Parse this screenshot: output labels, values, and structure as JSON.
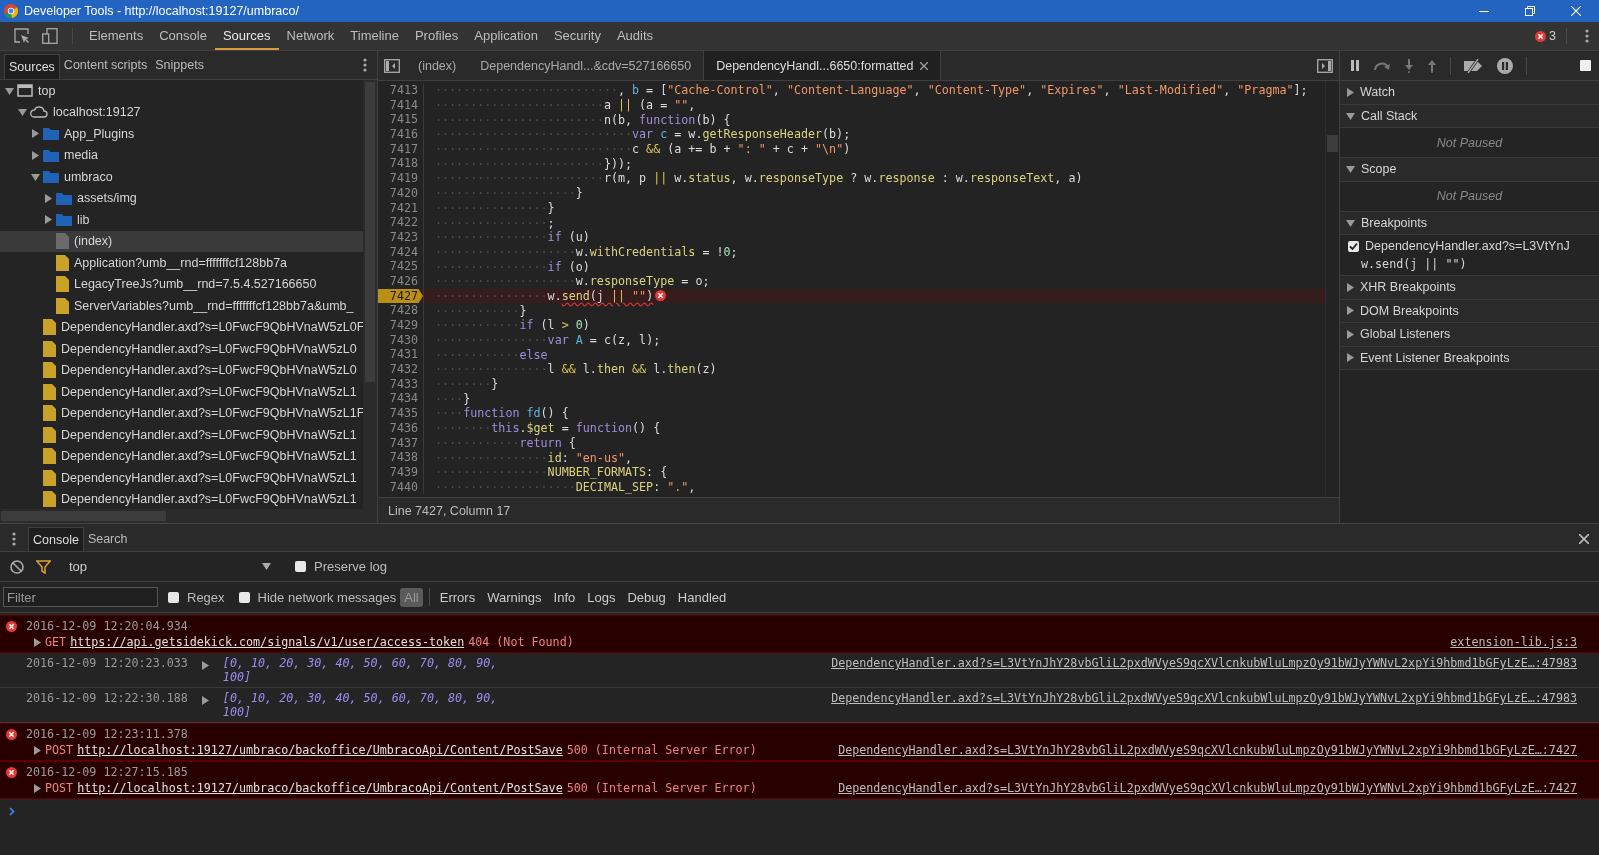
{
  "window": {
    "title": "Developer Tools - http://localhost:19127/umbraco/"
  },
  "main_tabs": [
    {
      "label": "Elements",
      "selected": false
    },
    {
      "label": "Console",
      "selected": false
    },
    {
      "label": "Sources",
      "selected": true
    },
    {
      "label": "Network",
      "selected": false
    },
    {
      "label": "Timeline",
      "selected": false
    },
    {
      "label": "Profiles",
      "selected": false
    },
    {
      "label": "Application",
      "selected": false
    },
    {
      "label": "Security",
      "selected": false
    },
    {
      "label": "Audits",
      "selected": false
    }
  ],
  "error_count": "3",
  "sidebar": {
    "tabs": [
      {
        "label": "Sources",
        "selected": true
      },
      {
        "label": "Content scripts",
        "selected": false
      },
      {
        "label": "Snippets",
        "selected": false
      }
    ],
    "tree": [
      {
        "label": "top",
        "kind": "frame",
        "expanded": true,
        "selected": false,
        "children": [
          {
            "label": "localhost:19127",
            "kind": "domain",
            "expanded": true,
            "selected": false,
            "children": [
              {
                "label": "App_Plugins",
                "kind": "folder",
                "expanded": false,
                "selected": false
              },
              {
                "label": "media",
                "kind": "folder",
                "expanded": false,
                "selected": false
              },
              {
                "label": "umbraco",
                "kind": "folder",
                "expanded": true,
                "selected": false,
                "children": [
                  {
                    "label": "assets/img",
                    "kind": "folder",
                    "expanded": false,
                    "selected": false
                  },
                  {
                    "label": "lib",
                    "kind": "folder",
                    "expanded": false,
                    "selected": false
                  },
                  {
                    "label": "(index)",
                    "kind": "document",
                    "selected": true
                  },
                  {
                    "label": "Application?umb__rnd=fffffffcf128bb7a",
                    "kind": "script",
                    "selected": false
                  },
                  {
                    "label": "LegacyTreeJs?umb__rnd=7.5.4.527166650",
                    "kind": "script",
                    "selected": false
                  },
                  {
                    "label": "ServerVariables?umb__rnd=fffffffcf128bb7a&umb_",
                    "kind": "script",
                    "selected": false
                  }
                ]
              },
              {
                "label": "DependencyHandler.axd?s=L0FwcF9QbHVnaW5zL0F",
                "kind": "script",
                "selected": false
              },
              {
                "label": "DependencyHandler.axd?s=L0FwcF9QbHVnaW5zL0",
                "kind": "script",
                "selected": false
              },
              {
                "label": "DependencyHandler.axd?s=L0FwcF9QbHVnaW5zL0",
                "kind": "script",
                "selected": false
              },
              {
                "label": "DependencyHandler.axd?s=L0FwcF9QbHVnaW5zL1",
                "kind": "script",
                "selected": false
              },
              {
                "label": "DependencyHandler.axd?s=L0FwcF9QbHVnaW5zL1F",
                "kind": "script",
                "selected": false
              },
              {
                "label": "DependencyHandler.axd?s=L0FwcF9QbHVnaW5zL1",
                "kind": "script",
                "selected": false
              },
              {
                "label": "DependencyHandler.axd?s=L0FwcF9QbHVnaW5zL1",
                "kind": "script",
                "selected": false
              },
              {
                "label": "DependencyHandler.axd?s=L0FwcF9QbHVnaW5zL1",
                "kind": "script",
                "selected": false
              },
              {
                "label": "DependencyHandler.axd?s=L0FwcF9QbHVnaW5zL1",
                "kind": "script",
                "selected": false
              }
            ]
          }
        ]
      }
    ]
  },
  "editor": {
    "tabs": [
      {
        "label": "(index)",
        "selected": false
      },
      {
        "label": "DependencyHandl...&cdv=527166650",
        "selected": false
      },
      {
        "label": "DependencyHandl...6650:formatted",
        "selected": true
      }
    ],
    "lines": [
      {
        "number": "7413",
        "breakpoint": false,
        "error": false,
        "segments": [
          {
            "kind": "whitespace",
            "text": "··························"
          },
          {
            "kind": "plain",
            "text": ", "
          },
          {
            "kind": "name",
            "text": "b"
          },
          {
            "kind": "plain",
            "text": " = ["
          },
          {
            "kind": "string",
            "text": "\"Cache-Control\""
          },
          {
            "kind": "plain",
            "text": ", "
          },
          {
            "kind": "string",
            "text": "\"Content-Language\""
          },
          {
            "kind": "plain",
            "text": ", "
          },
          {
            "kind": "string",
            "text": "\"Content-Type\""
          },
          {
            "kind": "plain",
            "text": ", "
          },
          {
            "kind": "string",
            "text": "\"Expires\""
          },
          {
            "kind": "plain",
            "text": ", "
          },
          {
            "kind": "string",
            "text": "\"Last-Modified\""
          },
          {
            "kind": "plain",
            "text": ", "
          },
          {
            "kind": "string",
            "text": "\"Pragma\""
          },
          {
            "kind": "plain",
            "text": "];"
          }
        ]
      },
      {
        "number": "7414",
        "breakpoint": false,
        "error": false,
        "segments": [
          {
            "kind": "whitespace",
            "text": "························"
          },
          {
            "kind": "plain",
            "text": "a "
          },
          {
            "kind": "operator",
            "text": "||"
          },
          {
            "kind": "plain",
            "text": " (a = "
          },
          {
            "kind": "string",
            "text": "\"\""
          },
          {
            "kind": "plain",
            "text": ","
          }
        ]
      },
      {
        "number": "7415",
        "breakpoint": false,
        "error": false,
        "segments": [
          {
            "kind": "whitespace",
            "text": "························"
          },
          {
            "kind": "plain",
            "text": "n(b, "
          },
          {
            "kind": "keyword",
            "text": "function"
          },
          {
            "kind": "plain",
            "text": "(b) {"
          }
        ]
      },
      {
        "number": "7416",
        "breakpoint": false,
        "error": false,
        "segments": [
          {
            "kind": "whitespace",
            "text": "····························"
          },
          {
            "kind": "keyword",
            "text": "var"
          },
          {
            "kind": "name",
            "text": " c"
          },
          {
            "kind": "plain",
            "text": " = w."
          },
          {
            "kind": "property",
            "text": "getResponseHeader"
          },
          {
            "kind": "plain",
            "text": "(b);"
          }
        ]
      },
      {
        "number": "7417",
        "breakpoint": false,
        "error": false,
        "segments": [
          {
            "kind": "whitespace",
            "text": "····························"
          },
          {
            "kind": "plain",
            "text": "c "
          },
          {
            "kind": "operator",
            "text": "&&"
          },
          {
            "kind": "plain",
            "text": " (a += b + "
          },
          {
            "kind": "string",
            "text": "\": \""
          },
          {
            "kind": "plain",
            "text": " + c + "
          },
          {
            "kind": "string",
            "text": "\"\\n\""
          },
          {
            "kind": "plain",
            "text": ")"
          }
        ]
      },
      {
        "number": "7418",
        "breakpoint": false,
        "error": false,
        "segments": [
          {
            "kind": "whitespace",
            "text": "························"
          },
          {
            "kind": "plain",
            "text": "}));"
          }
        ]
      },
      {
        "number": "7419",
        "breakpoint": false,
        "error": false,
        "segments": [
          {
            "kind": "whitespace",
            "text": "························"
          },
          {
            "kind": "plain",
            "text": "r(m, p "
          },
          {
            "kind": "operator",
            "text": "||"
          },
          {
            "kind": "plain",
            "text": " w."
          },
          {
            "kind": "property",
            "text": "status"
          },
          {
            "kind": "plain",
            "text": ", w."
          },
          {
            "kind": "property",
            "text": "responseType"
          },
          {
            "kind": "plain",
            "text": " ? w."
          },
          {
            "kind": "property",
            "text": "response"
          },
          {
            "kind": "plain",
            "text": " : w."
          },
          {
            "kind": "property",
            "text": "responseText"
          },
          {
            "kind": "plain",
            "text": ", a)"
          }
        ]
      },
      {
        "number": "7420",
        "breakpoint": false,
        "error": false,
        "segments": [
          {
            "kind": "whitespace",
            "text": "····················"
          },
          {
            "kind": "plain",
            "text": "}"
          }
        ]
      },
      {
        "number": "7421",
        "breakpoint": false,
        "error": false,
        "segments": [
          {
            "kind": "whitespace",
            "text": "················"
          },
          {
            "kind": "plain",
            "text": "}"
          }
        ]
      },
      {
        "number": "7422",
        "breakpoint": false,
        "error": false,
        "segments": [
          {
            "kind": "whitespace",
            "text": "················"
          },
          {
            "kind": "plain",
            "text": ";"
          }
        ]
      },
      {
        "number": "7423",
        "breakpoint": false,
        "error": false,
        "segments": [
          {
            "kind": "whitespace",
            "text": "················"
          },
          {
            "kind": "keyword",
            "text": "if"
          },
          {
            "kind": "plain",
            "text": " (u)"
          }
        ]
      },
      {
        "number": "7424",
        "breakpoint": false,
        "error": false,
        "segments": [
          {
            "kind": "whitespace",
            "text": "····················"
          },
          {
            "kind": "plain",
            "text": "w."
          },
          {
            "kind": "property",
            "text": "withCredentials"
          },
          {
            "kind": "plain",
            "text": " = !"
          },
          {
            "kind": "number",
            "text": "0"
          },
          {
            "kind": "plain",
            "text": ";"
          }
        ]
      },
      {
        "number": "7425",
        "breakpoint": false,
        "error": false,
        "segments": [
          {
            "kind": "whitespace",
            "text": "················"
          },
          {
            "kind": "keyword",
            "text": "if"
          },
          {
            "kind": "plain",
            "text": " (o)"
          }
        ]
      },
      {
        "number": "7426",
        "breakpoint": false,
        "error": false,
        "segments": [
          {
            "kind": "whitespace",
            "text": "····················"
          },
          {
            "kind": "plain",
            "text": "w."
          },
          {
            "kind": "property",
            "text": "responseType"
          },
          {
            "kind": "plain",
            "text": " = o;"
          }
        ]
      },
      {
        "number": "7427",
        "breakpoint": true,
        "error": true,
        "segments": [
          {
            "kind": "whitespace",
            "text": "················"
          },
          {
            "kind": "plain",
            "text": "w."
          },
          {
            "kind": "property",
            "text": "send",
            "squiggle": true
          },
          {
            "kind": "plain",
            "text": "(j ",
            "squiggle": true
          },
          {
            "kind": "operator",
            "text": "||",
            "squiggle": true
          },
          {
            "kind": "string",
            "text": " \"\"",
            "squiggle": true
          },
          {
            "kind": "plain",
            "text": ")",
            "squiggle": true
          }
        ]
      },
      {
        "number": "7428",
        "breakpoint": false,
        "error": false,
        "segments": [
          {
            "kind": "whitespace",
            "text": "············"
          },
          {
            "kind": "plain",
            "text": "}"
          }
        ]
      },
      {
        "number": "7429",
        "breakpoint": false,
        "error": false,
        "segments": [
          {
            "kind": "whitespace",
            "text": "············"
          },
          {
            "kind": "keyword",
            "text": "if"
          },
          {
            "kind": "plain",
            "text": " (l "
          },
          {
            "kind": "operator",
            "text": ">"
          },
          {
            "kind": "number",
            "text": " 0"
          },
          {
            "kind": "plain",
            "text": ")"
          }
        ]
      },
      {
        "number": "7430",
        "breakpoint": false,
        "error": false,
        "segments": [
          {
            "kind": "whitespace",
            "text": "················"
          },
          {
            "kind": "keyword",
            "text": "var"
          },
          {
            "kind": "name",
            "text": " A"
          },
          {
            "kind": "plain",
            "text": " = c(z, l);"
          }
        ]
      },
      {
        "number": "7431",
        "breakpoint": false,
        "error": false,
        "segments": [
          {
            "kind": "whitespace",
            "text": "············"
          },
          {
            "kind": "keyword",
            "text": "else"
          }
        ]
      },
      {
        "number": "7432",
        "breakpoint": false,
        "error": false,
        "segments": [
          {
            "kind": "whitespace",
            "text": "················"
          },
          {
            "kind": "plain",
            "text": "l "
          },
          {
            "kind": "operator",
            "text": "&&"
          },
          {
            "kind": "plain",
            "text": " l."
          },
          {
            "kind": "property",
            "text": "then"
          },
          {
            "kind": "operator",
            "text": " &&"
          },
          {
            "kind": "plain",
            "text": " l."
          },
          {
            "kind": "property",
            "text": "then"
          },
          {
            "kind": "plain",
            "text": "(z)"
          }
        ]
      },
      {
        "number": "7433",
        "breakpoint": false,
        "error": false,
        "segments": [
          {
            "kind": "whitespace",
            "text": "········"
          },
          {
            "kind": "plain",
            "text": "}"
          }
        ]
      },
      {
        "number": "7434",
        "breakpoint": false,
        "error": false,
        "segments": [
          {
            "kind": "whitespace",
            "text": "····"
          },
          {
            "kind": "plain",
            "text": "}"
          }
        ]
      },
      {
        "number": "7435",
        "breakpoint": false,
        "error": false,
        "segments": [
          {
            "kind": "whitespace",
            "text": "····"
          },
          {
            "kind": "keyword",
            "text": "function"
          },
          {
            "kind": "name",
            "text": " fd"
          },
          {
            "kind": "plain",
            "text": "() {"
          }
        ]
      },
      {
        "number": "7436",
        "breakpoint": false,
        "error": false,
        "segments": [
          {
            "kind": "whitespace",
            "text": "········"
          },
          {
            "kind": "keyword",
            "text": "this"
          },
          {
            "kind": "plain",
            "text": "."
          },
          {
            "kind": "property",
            "text": "$get"
          },
          {
            "kind": "plain",
            "text": " = "
          },
          {
            "kind": "keyword",
            "text": "function"
          },
          {
            "kind": "plain",
            "text": "() {"
          }
        ]
      },
      {
        "number": "7437",
        "breakpoint": false,
        "error": false,
        "segments": [
          {
            "kind": "whitespace",
            "text": "············"
          },
          {
            "kind": "keyword",
            "text": "return"
          },
          {
            "kind": "plain",
            "text": " {"
          }
        ]
      },
      {
        "number": "7438",
        "breakpoint": false,
        "error": false,
        "segments": [
          {
            "kind": "whitespace",
            "text": "················"
          },
          {
            "kind": "property",
            "text": "id"
          },
          {
            "kind": "plain",
            "text": ": "
          },
          {
            "kind": "string",
            "text": "\"en-us\""
          },
          {
            "kind": "plain",
            "text": ","
          }
        ]
      },
      {
        "number": "7439",
        "breakpoint": false,
        "error": false,
        "segments": [
          {
            "kind": "whitespace",
            "text": "················"
          },
          {
            "kind": "property",
            "text": "NUMBER_FORMATS"
          },
          {
            "kind": "plain",
            "text": ": {"
          }
        ]
      },
      {
        "number": "7440",
        "breakpoint": false,
        "error": false,
        "segments": [
          {
            "kind": "whitespace",
            "text": "····················"
          },
          {
            "kind": "property",
            "text": "DECIMAL_SEP"
          },
          {
            "kind": "plain",
            "text": ": "
          },
          {
            "kind": "string",
            "text": "\".\""
          },
          {
            "kind": "plain",
            "text": ","
          }
        ]
      }
    ],
    "status": "Line 7427, Column 17"
  },
  "debugger": {
    "toggle_checked": false,
    "sections": [
      {
        "title": "Watch",
        "expanded": false
      },
      {
        "title": "Call Stack",
        "expanded": true,
        "message": "Not Paused"
      },
      {
        "title": "Scope",
        "expanded": true,
        "message": "Not Paused"
      },
      {
        "title": "Breakpoints",
        "expanded": true,
        "items": [
          {
            "file": "DependencyHandler.axd?s=L3VtYnJ",
            "code": "w.send(j || \"\")",
            "checked": true
          }
        ]
      },
      {
        "title": "XHR Breakpoints",
        "expanded": false
      },
      {
        "title": "DOM Breakpoints",
        "expanded": false
      },
      {
        "title": "Global Listeners",
        "expanded": false
      },
      {
        "title": "Event Listener Breakpoints",
        "expanded": false
      }
    ]
  },
  "drawer": {
    "tabs": [
      {
        "label": "Console",
        "selected": true
      },
      {
        "label": "Search",
        "selected": false
      }
    ],
    "context": "top",
    "preserve_log": {
      "label": "Preserve log",
      "checked": false
    },
    "filter": {
      "placeholder": "Filter"
    },
    "regex": {
      "label": "Regex",
      "checked": false
    },
    "hide_network": {
      "label": "Hide network messages",
      "checked": false
    },
    "levels": [
      {
        "label": "All",
        "selected": true
      },
      {
        "label": "Errors",
        "selected": false
      },
      {
        "label": "Warnings",
        "selected": false
      },
      {
        "label": "Info",
        "selected": false
      },
      {
        "label": "Logs",
        "selected": false
      },
      {
        "label": "Debug",
        "selected": false
      },
      {
        "label": "Handled",
        "selected": false
      }
    ],
    "messages": [
      {
        "kind": "error",
        "timestamp": "2016-12-09 12:20:04.934",
        "method": "GET",
        "url": "https://api.getsidekick.com/signals/v1/user/access-token",
        "status": "404 (Not Found)",
        "source": "extension-lib.js:3"
      },
      {
        "kind": "log",
        "timestamp": "2016-12-09 12:20:23.033",
        "lines": [
          "[0, 10, 20, 30, 40, 50, 60, 70, 80, 90,",
          "100]"
        ],
        "source": "DependencyHandler.axd?s=L3VtYnJhY28vbGliL2pxdWVyeS9qcXVlcnkubWluLmpzOy91bWJyYWNvL2xpYi9hbmd1bGFyLzE…:47983"
      },
      {
        "kind": "log",
        "timestamp": "2016-12-09 12:22:30.188",
        "lines": [
          "[0, 10, 20, 30, 40, 50, 60, 70, 80, 90,",
          "100]"
        ],
        "source": "DependencyHandler.axd?s=L3VtYnJhY28vbGliL2pxdWVyeS9qcXVlcnkubWluLmpzOy91bWJyYWNvL2xpYi9hbmd1bGFyLzE…:47983"
      },
      {
        "kind": "error",
        "timestamp": "2016-12-09 12:23:11.378",
        "method": "POST",
        "url": "http://localhost:19127/umbraco/backoffice/UmbracoApi/Content/PostSave",
        "status": "500 (Internal Server Error)",
        "source": "DependencyHandler.axd?s=L3VtYnJhY28vbGliL2pxdWVyeS9qcXVlcnkubWluLmpzOy91bWJyYWNvL2xpYi9hbmd1bGFyLzE…:7427"
      },
      {
        "kind": "error",
        "timestamp": "2016-12-09 12:27:15.185",
        "method": "POST",
        "url": "http://localhost:19127/umbraco/backoffice/UmbracoApi/Content/PostSave",
        "status": "500 (Internal Server Error)",
        "source": "DependencyHandler.axd?s=L3VtYnJhY28vbGliL2pxdWVyeS9qcXVlcnkubWluLmpzOy91bWJyYWNvL2xpYi9hbmd1bGFyLzE…:7427"
      }
    ]
  }
}
